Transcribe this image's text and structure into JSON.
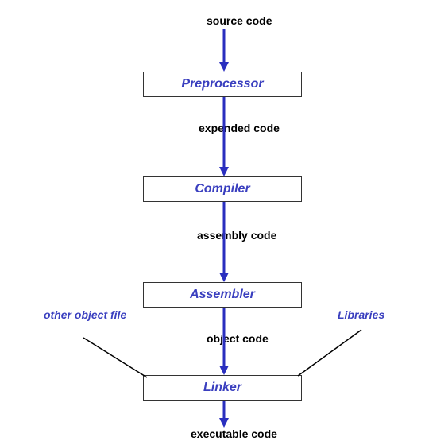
{
  "labels": {
    "source": "source code",
    "expended": "expended code",
    "assembly": "assembly code",
    "object": "object code",
    "executable": "executable code",
    "other_object": "other object file",
    "libraries": "Libraries"
  },
  "stages": {
    "preprocessor": "Preprocessor",
    "compiler": "Compiler",
    "assembler": "Assembler",
    "linker": "Linker"
  },
  "colors": {
    "arrow": "#2a2fbf",
    "box_text": "#3a3fbf"
  }
}
